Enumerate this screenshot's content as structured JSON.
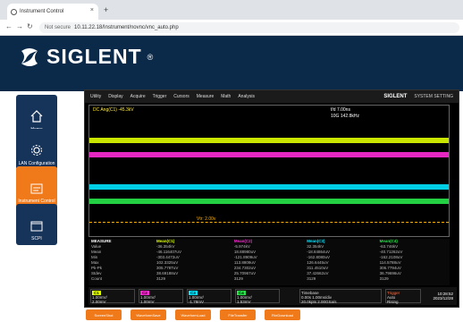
{
  "browser": {
    "tab_title": "Instrument Control",
    "tab_close": "×",
    "new_tab": "+",
    "not_secure": "Not secure",
    "url": "10.11.22.18/Instrument/novnc/vnc_auto.php"
  },
  "header": {
    "brand": "SIGLENT",
    "reg": "®"
  },
  "sidebar": {
    "items": [
      {
        "label": "Home",
        "icon": "home-icon"
      },
      {
        "label": "LAN Configuration",
        "icon": "gear-icon"
      },
      {
        "label": "Instrument Control",
        "icon": "instrument-icon",
        "active": true
      },
      {
        "label": "SCPI",
        "icon": "terminal-icon"
      }
    ]
  },
  "scope": {
    "menu": [
      "Utility",
      "Display",
      "Acquire",
      "Trigger",
      "Cursors",
      "Measure",
      "Math",
      "Analysis"
    ],
    "brand": "SIGLENT",
    "system": "SYSTEM SETTING",
    "left_info": "DC Ang(C1) -45.3kV",
    "top_info_1": "f/d 7.00ns",
    "top_info_2": "10G 142.8kHz",
    "bottom_info": "Vtr: 2.00v",
    "measure": {
      "headers": [
        "MEASURE",
        "Mean(C1)",
        "Mean(C2)",
        "Mean(C3)",
        "Mean(C4)"
      ],
      "rows": [
        [
          "Value",
          "-36.354kV",
          "-5.974kV",
          "32.354kV",
          "-63.746kV"
        ],
        [
          "Mean",
          "-46.116407uV",
          "18.88980uV",
          "-18.84864uV",
          "-40.71262uV"
        ],
        [
          "Min",
          "-303.4472uV",
          "-121.8909uV",
          "-162.8080uV",
          "-162.2108uV"
        ],
        [
          "Max",
          "102.3325uV",
          "113.8809uV",
          "126.6445uV",
          "114.5788uV"
        ],
        [
          "Pk-Pk",
          "305.778TuV",
          "234.7302uV",
          "311.4510uV",
          "306.7794uV"
        ],
        [
          "Stdev",
          "38.69188uV",
          "25.70967uV",
          "37.42662uV",
          "36.79696uV"
        ],
        [
          "Count",
          "3129",
          "3129",
          "3129",
          "3129"
        ]
      ]
    },
    "channels": [
      {
        "name": "C1",
        "v1": "1.00mV/",
        "v2": "2.00mV"
      },
      {
        "name": "C2",
        "v1": "1.00mV/",
        "v2": "1.00mV"
      },
      {
        "name": "C3",
        "v1": "1.00mV/",
        "v2": "-1.78mV"
      },
      {
        "name": "C4",
        "v1": "1.00mV/",
        "v2": "1.53mV"
      }
    ],
    "timebase": {
      "label": "Timebase",
      "line1": "0.00s  1.00ms/div",
      "line2": "20.0kpts 2.00GSa/s"
    },
    "trigger": {
      "label": "Trigger",
      "line1": "Auto",
      "line2": "Rising"
    },
    "time": "10:28:52",
    "date": "2023/12/28"
  },
  "bottom_buttons": [
    "ScreenShot",
    "WaveformSave",
    "WaveformLoad",
    "FileTransfer",
    "FileDownload"
  ]
}
